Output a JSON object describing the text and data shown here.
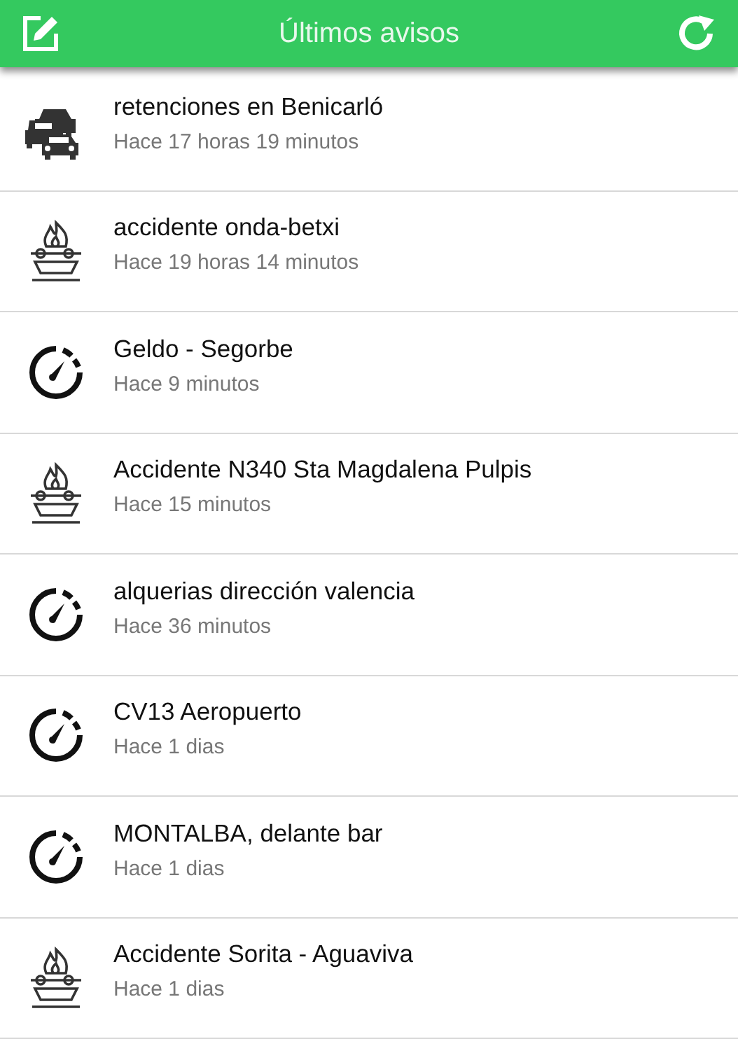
{
  "header": {
    "title": "Últimos avisos"
  },
  "alerts": [
    {
      "kind": "traffic",
      "title": "retenciones en Benicarló",
      "time": "Hace 17 horas 19 minutos"
    },
    {
      "kind": "accident",
      "title": "accidente onda-betxi",
      "time": "Hace 19 horas 14 minutos"
    },
    {
      "kind": "speed",
      "title": "Geldo - Segorbe",
      "time": "Hace 9 minutos"
    },
    {
      "kind": "accident",
      "title": "Accidente N340 Sta Magdalena Pulpis",
      "time": "Hace 15 minutos"
    },
    {
      "kind": "speed",
      "title": "alquerias dirección valencia",
      "time": "Hace 36 minutos"
    },
    {
      "kind": "speed",
      "title": "CV13 Aeropuerto",
      "time": "Hace 1 dias"
    },
    {
      "kind": "speed",
      "title": "MONTALBA, delante bar",
      "time": "Hace 1 dias"
    },
    {
      "kind": "accident",
      "title": "Accidente Sorita - Aguaviva",
      "time": "Hace 1 dias"
    }
  ]
}
